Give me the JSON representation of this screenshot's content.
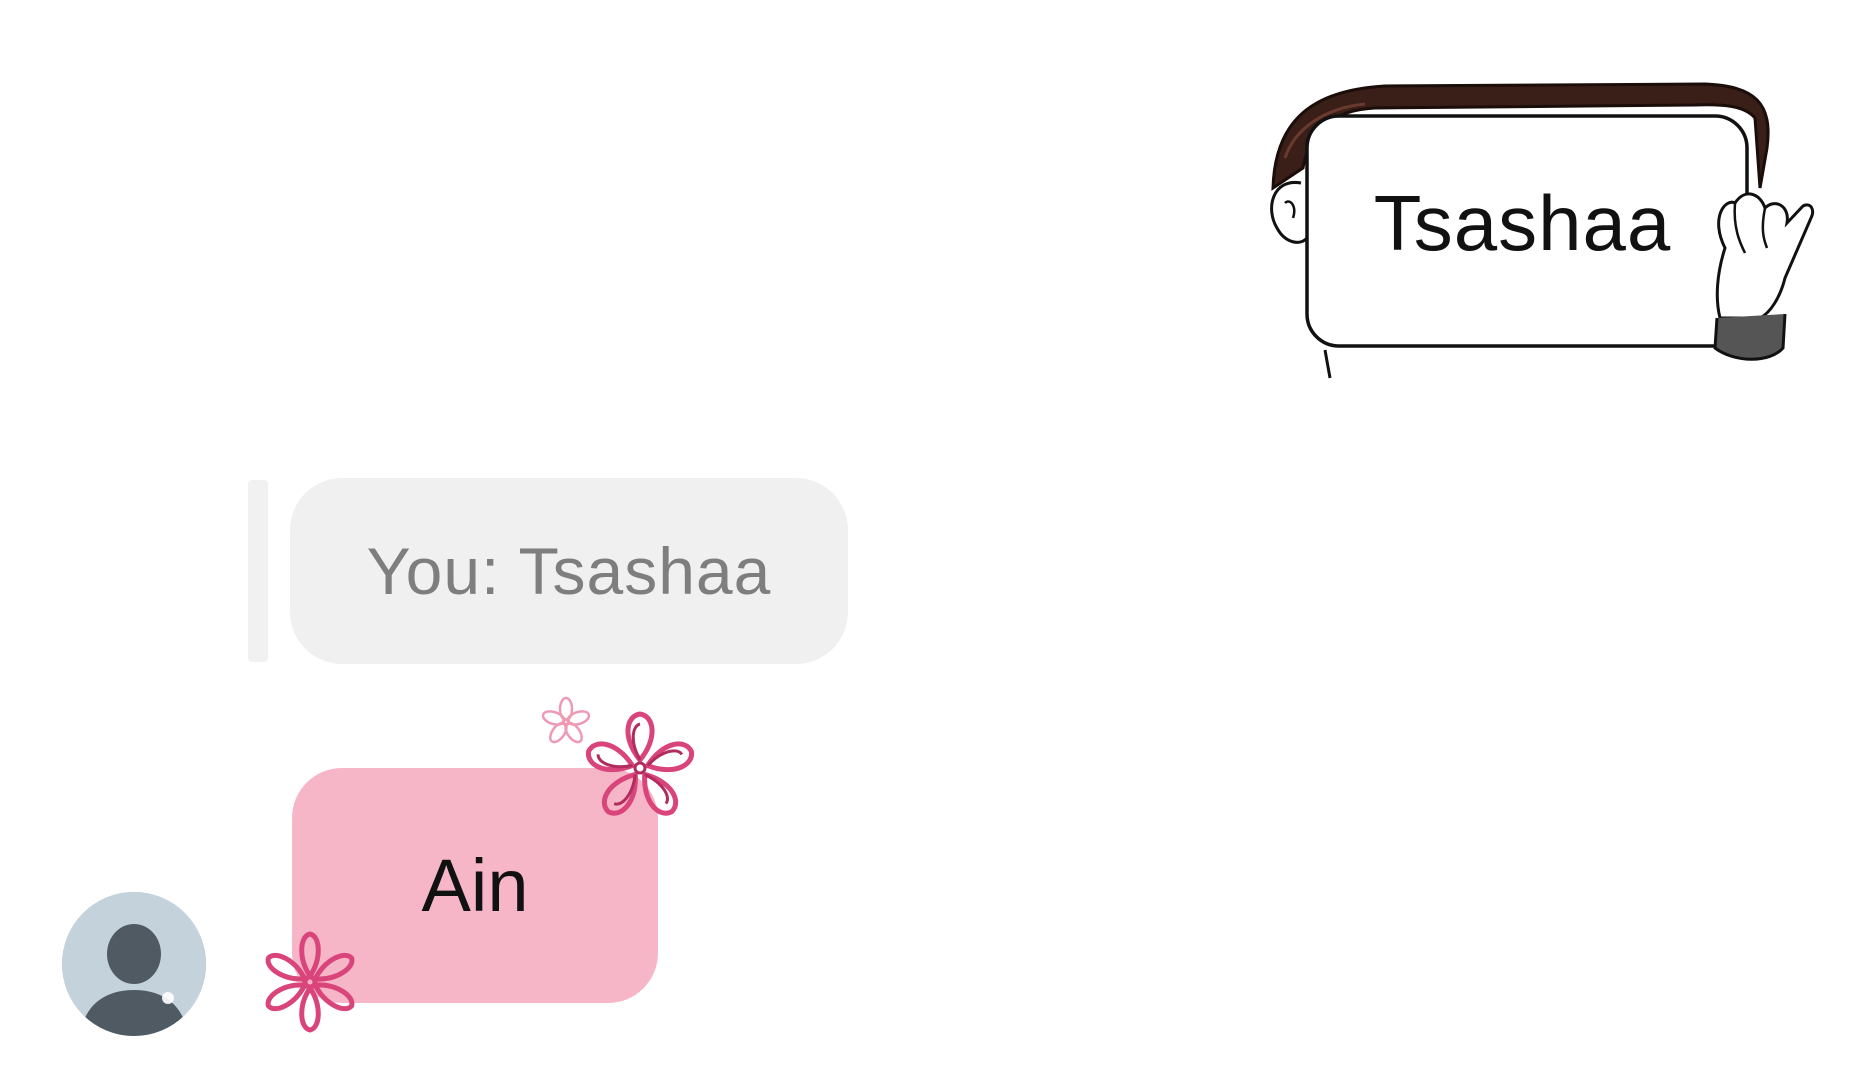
{
  "conversation": {
    "sticker_message": {
      "text": "Tsashaa",
      "sticker": "man-holding-sign"
    },
    "reply_quote": {
      "text": "You: Tsashaa"
    },
    "incoming_message": {
      "text": "Ain",
      "bubble_color": "#f6b6c8",
      "decoration": "pink-flower-doodles"
    },
    "avatar": {
      "icon": "default-user-icon",
      "background": "#c4d2dc"
    }
  },
  "colors": {
    "background": "#ffffff",
    "reply_bubble": "#f0f0f0",
    "reply_text": "#7e7e7e",
    "flower_outline": "#d9457a",
    "hair": "#3a1e18"
  }
}
